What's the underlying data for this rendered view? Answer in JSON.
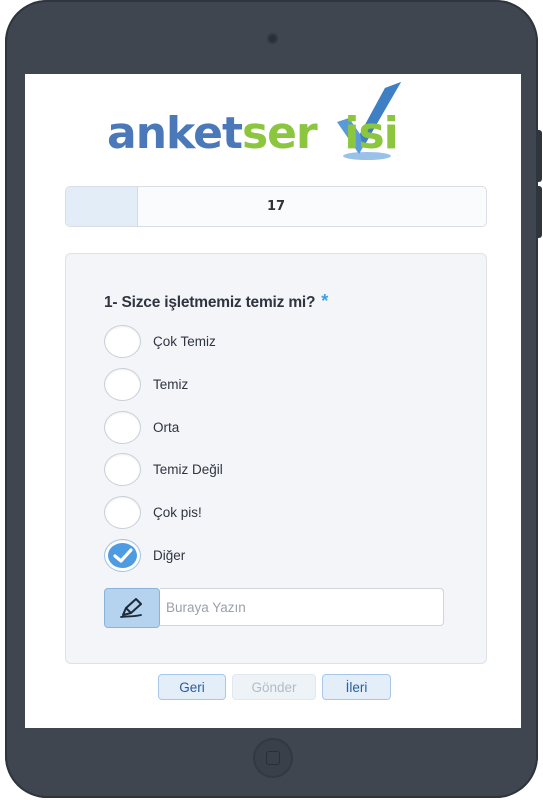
{
  "logo": {
    "part_blue": "anket",
    "part_green_1": "ser",
    "part_blue_v": "v",
    "part_green_2": "isi",
    "alt": "anketservisi"
  },
  "progress": {
    "value_label": "17",
    "fraction": 0.17
  },
  "question": {
    "title": "1- Sizce işletmemiz temiz mi?",
    "required_mark": "*",
    "options": [
      {
        "label": "Çok Temiz",
        "checked": false
      },
      {
        "label": "Temiz",
        "checked": false
      },
      {
        "label": "Orta",
        "checked": false
      },
      {
        "label": "Temiz Değil",
        "checked": false
      },
      {
        "label": "Çok pis!",
        "checked": false
      },
      {
        "label": "Diğer",
        "checked": true
      }
    ],
    "other_input": {
      "placeholder": "Buraya Yazın",
      "value": "",
      "icon": "pencil-icon"
    }
  },
  "nav": {
    "back_label": "Geri",
    "submit_label": "Gönder",
    "next_label": "İleri"
  },
  "colors": {
    "frame": "#3f4650",
    "accent": "#4d9be0",
    "logo_blue": "#4a78b8",
    "logo_green": "#8cc63f",
    "required": "#3aa0e8"
  }
}
